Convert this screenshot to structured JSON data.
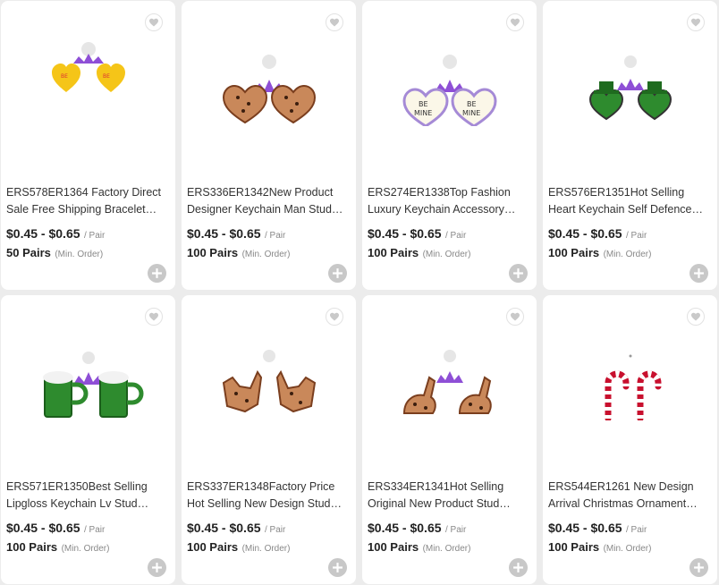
{
  "products": [
    {
      "title": "ERS578ER1364 Factory Direct Sale Free Shipping Bracelet Earrings",
      "price": "$0.45 - $0.65",
      "unit": "/ Pair",
      "moq": "50 Pairs",
      "min_order": "(Min. Order)",
      "image_icon": "earrings-yellow-hearts-icon"
    },
    {
      "title": "ERS336ER1342New Product Designer Keychain Man Stud Earrings",
      "price": "$0.45 - $0.65",
      "unit": "/ Pair",
      "moq": "100 Pairs",
      "min_order": "(Min. Order)",
      "image_icon": "earrings-leopard-hearts-icon"
    },
    {
      "title": "ERS274ER1338Top Fashion Luxury Keychain Accessory Earrings",
      "price": "$0.45 - $0.65",
      "unit": "/ Pair",
      "moq": "100 Pairs",
      "min_order": "(Min. Order)",
      "image_icon": "earrings-be-mine-hearts-icon"
    },
    {
      "title": "ERS576ER1351Hot Selling Heart Keychain Self Defence Earrings",
      "price": "$0.45 - $0.65",
      "unit": "/ Pair",
      "moq": "100 Pairs",
      "min_order": "(Min. Order)",
      "image_icon": "earrings-green-hat-hearts-icon"
    },
    {
      "title": "ERS571ER1350Best Selling Lipgloss Keychain Lv Stud Earrings",
      "price": "$0.45 - $0.65",
      "unit": "/ Pair",
      "moq": "100 Pairs",
      "min_order": "(Min. Order)",
      "image_icon": "earrings-green-mugs-icon"
    },
    {
      "title": "ERS337ER1348Factory Price Hot Selling New Design Stud Earrings",
      "price": "$0.45 - $0.65",
      "unit": "/ Pair",
      "moq": "100 Pairs",
      "min_order": "(Min. Order)",
      "image_icon": "earrings-leopard-chickens-icon"
    },
    {
      "title": "ERS334ER1341Hot Selling Original New Product Stud Earrings",
      "price": "$0.45 - $0.65",
      "unit": "/ Pair",
      "moq": "100 Pairs",
      "min_order": "(Min. Order)",
      "image_icon": "earrings-leopard-bunnies-icon"
    },
    {
      "title": "ERS544ER1261 New Design Arrival Christmas Ornament Earrings",
      "price": "$0.45 - $0.65",
      "unit": "/ Pair",
      "moq": "100 Pairs",
      "min_order": "(Min. Order)",
      "image_icon": "earrings-candy-canes-icon"
    }
  ],
  "colors": {
    "leopard": "#c9885a",
    "purple": "#8e4fd6",
    "green": "#2e8b2e",
    "red": "#c8102e",
    "yellow": "#f5c518"
  }
}
